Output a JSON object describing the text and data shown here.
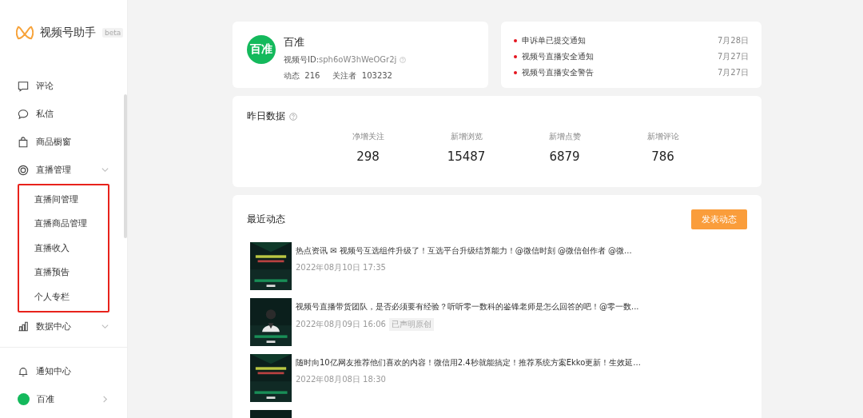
{
  "sidebar": {
    "logo": "视频号助手",
    "badge": "beta",
    "items": [
      {
        "label": "评论",
        "kind": "comment"
      },
      {
        "label": "私信",
        "kind": "message"
      },
      {
        "label": "商品橱窗",
        "kind": "bag"
      },
      {
        "label": "直播管理",
        "kind": "live",
        "expanded": true,
        "highlighted": true,
        "children": [
          {
            "label": "直播间管理"
          },
          {
            "label": "直播商品管理"
          },
          {
            "label": "直播收入"
          },
          {
            "label": "直播预告"
          },
          {
            "label": "个人专栏"
          }
        ]
      },
      {
        "label": "数据中心",
        "kind": "data",
        "expanded": false
      }
    ],
    "footer": [
      {
        "label": "通知中心",
        "kind": "bell"
      },
      {
        "label": "百准",
        "kind": "account"
      }
    ]
  },
  "profile": {
    "avatar_text": "百准",
    "name": "百准",
    "id_label": "视频号ID:",
    "id_value": "sph6oW3hWeOGr2j",
    "posts_label": "动态",
    "posts": "216",
    "followers_label": "关注者",
    "followers": "103232"
  },
  "notices": [
    {
      "title": "申诉单已提交通知",
      "date": "7月28日",
      "unread": true
    },
    {
      "title": "视频号直播安全通知",
      "date": "7月27日",
      "unread": true
    },
    {
      "title": "视频号直播安全警告",
      "date": "7月27日",
      "unread": true
    }
  ],
  "yesterday": {
    "title": "昨日数据",
    "stats": [
      {
        "label": "净增关注",
        "value": "298"
      },
      {
        "label": "新增浏览",
        "value": "15487"
      },
      {
        "label": "新增点赞",
        "value": "6879"
      },
      {
        "label": "新增评论",
        "value": "786"
      }
    ]
  },
  "recent": {
    "title": "最近动态",
    "button": "发表动态",
    "posts": [
      {
        "text": "热点资讯 ✉ 视频号互选组件升级了！互选平台升级结算能力！@微信时刻 @微信创作者 @微...",
        "date": "2022年08月10日 17:35"
      },
      {
        "text": "视频号直播带货团队，是否必须要有经验？听听零一数科的鉴锋老师是怎么回答的吧！@零一数...",
        "date": "2022年08月09日 16:06",
        "tag": "已声明原创"
      },
      {
        "text": "随时向10亿网友推荐他们喜欢的内容！微信用2.4秒就能搞定！推荐系统方案Ekko更新！生效延...",
        "date": "2022年08月08日 18:30"
      },
      {
        "kind": "picture"
      }
    ]
  }
}
